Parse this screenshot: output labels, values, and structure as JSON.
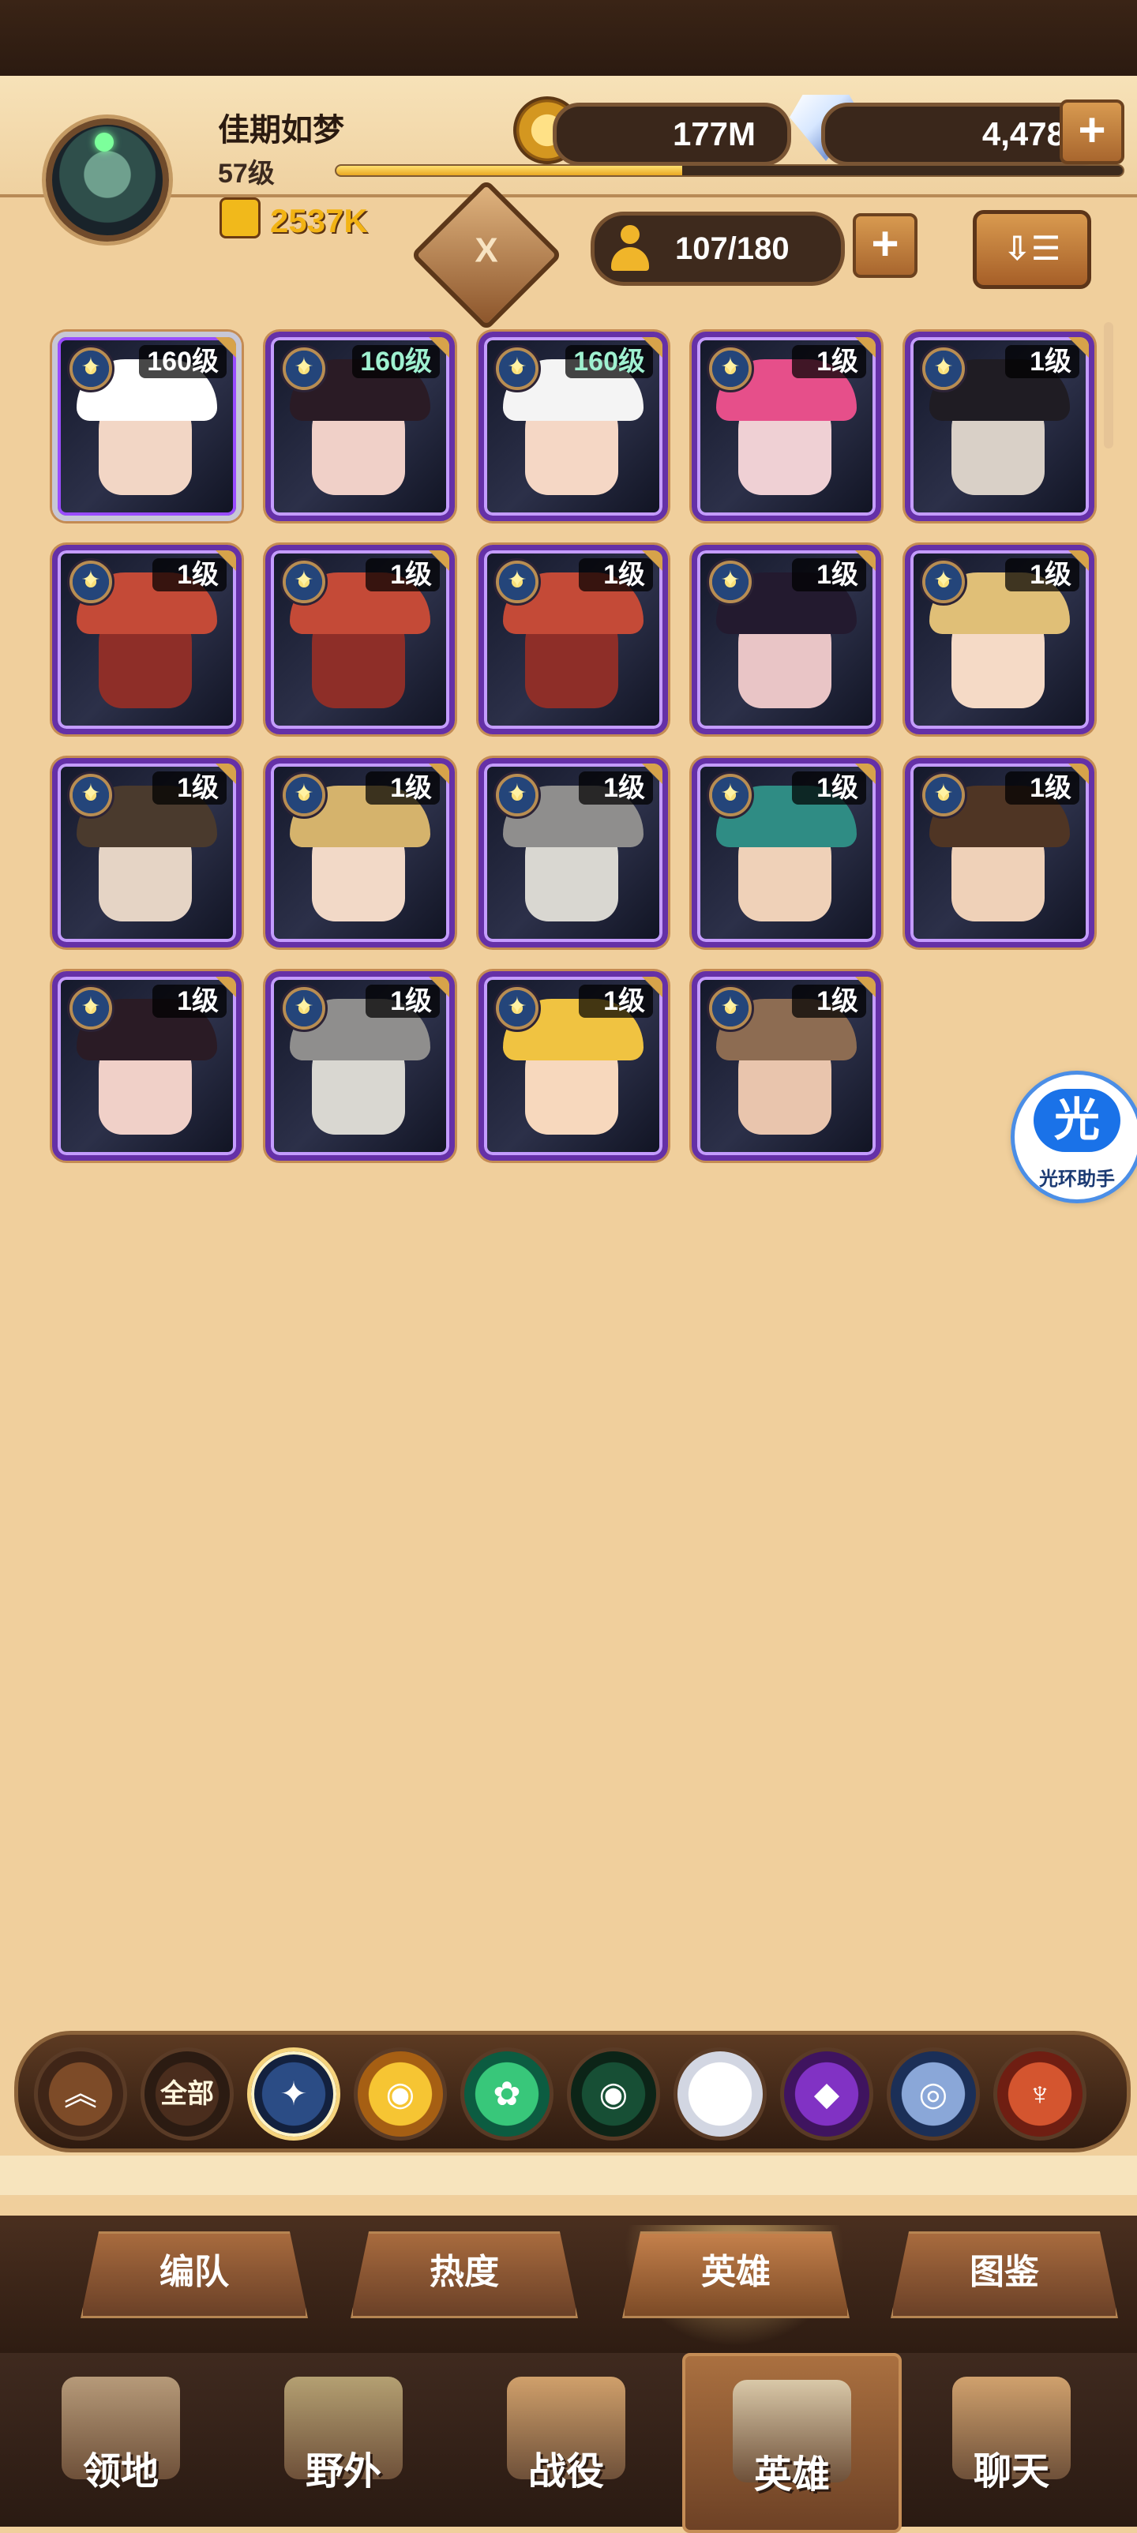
{
  "top": {
    "player_name": "佳期如梦",
    "player_level": "57级",
    "power": "2537K",
    "gold": "177M",
    "gems": "4,478",
    "plus": "+",
    "hero_count": "107/180",
    "formation_symbol": "X",
    "sort_symbol": "⇩☰",
    "xp_fraction": 0.44
  },
  "heroes": [
    {
      "level": "160级",
      "face": "#f2d6c5",
      "hair": "#ffffff",
      "gold": true,
      "green": false
    },
    {
      "level": "160级",
      "face": "#f0d0c8",
      "hair": "#2a1b25",
      "gold": false,
      "green": true
    },
    {
      "level": "160级",
      "face": "#f5d7c5",
      "hair": "#f4f4f4",
      "gold": false,
      "green": true
    },
    {
      "level": "1级",
      "face": "#efd0d4",
      "hair": "#e64f8a",
      "gold": false,
      "green": false
    },
    {
      "level": "1级",
      "face": "#d9d0c7",
      "hair": "#1f1c23",
      "gold": false,
      "green": false
    },
    {
      "level": "1级",
      "face": "#8e2e28",
      "hair": "#c44a37",
      "gold": false,
      "green": false
    },
    {
      "level": "1级",
      "face": "#8e2e28",
      "hair": "#c44a37",
      "gold": false,
      "green": false
    },
    {
      "level": "1级",
      "face": "#8e2e28",
      "hair": "#c44a37",
      "gold": false,
      "green": false
    },
    {
      "level": "1级",
      "face": "#e9c5c6",
      "hair": "#231a2f",
      "gold": false,
      "green": false
    },
    {
      "level": "1级",
      "face": "#f5dac6",
      "hair": "#e0bf77",
      "gold": false,
      "green": false
    },
    {
      "level": "1级",
      "face": "#e5d4c5",
      "hair": "#4a3a2d",
      "gold": false,
      "green": false
    },
    {
      "level": "1级",
      "face": "#f2d9c7",
      "hair": "#d5b36c",
      "gold": false,
      "green": false
    },
    {
      "level": "1级",
      "face": "#d9d7d1",
      "hair": "#8f8e8d",
      "gold": false,
      "green": false
    },
    {
      "level": "1级",
      "face": "#efd1b8",
      "hair": "#2f8c84",
      "gold": false,
      "green": false
    },
    {
      "level": "1级",
      "face": "#efd1b8",
      "hair": "#4f3524",
      "gold": false,
      "green": false
    },
    {
      "level": "1级",
      "face": "#f0d0c8",
      "hair": "#2a1b25",
      "gold": false,
      "green": false
    },
    {
      "level": "1级",
      "face": "#d9d7d1",
      "hair": "#8f8e8d",
      "gold": false,
      "green": false
    },
    {
      "level": "1级",
      "face": "#f7d8bd",
      "hair": "#f0c341",
      "gold": false,
      "green": false
    },
    {
      "level": "1级",
      "face": "#e9c5ad",
      "hair": "#8d6c52",
      "gold": false,
      "green": false
    }
  ],
  "helper": {
    "icon_text": "光",
    "label": "光环助手"
  },
  "filters": [
    {
      "label": "",
      "icon": "︽",
      "active": false,
      "c1": "#7d4b28",
      "c2": "#3f2517"
    },
    {
      "label": "全部",
      "icon": "",
      "active": false,
      "c1": "#4a2d1d",
      "c2": "#2b1b12"
    },
    {
      "label": "",
      "icon": "✦",
      "active": true,
      "c1": "#2b4c85",
      "c2": "#13213e"
    },
    {
      "label": "",
      "icon": "◉",
      "active": false,
      "c1": "#f6c533",
      "c2": "#a65f13"
    },
    {
      "label": "",
      "icon": "✿",
      "active": false,
      "c1": "#38c77a",
      "c2": "#0c5c41"
    },
    {
      "label": "",
      "icon": "◉",
      "active": false,
      "c1": "#174f35",
      "c2": "#0c2417"
    },
    {
      "label": "",
      "icon": "✦",
      "active": false,
      "c1": "#ffffff",
      "c2": "#d2d6e2"
    },
    {
      "label": "",
      "icon": "◆",
      "active": false,
      "c1": "#8132c4",
      "c2": "#3f145f"
    },
    {
      "label": "",
      "icon": "◎",
      "active": false,
      "c1": "#8aa7d8",
      "c2": "#1b2f57"
    },
    {
      "label": "",
      "icon": "♆",
      "active": false,
      "c1": "#d4552f",
      "c2": "#6f1e12"
    }
  ],
  "tabs": [
    {
      "label": "编队"
    },
    {
      "label": "热度"
    },
    {
      "label": "英雄"
    },
    {
      "label": "图鉴"
    }
  ],
  "nav": [
    {
      "label": "领地"
    },
    {
      "label": "野外"
    },
    {
      "label": "战役"
    },
    {
      "label": "英雄"
    },
    {
      "label": "聊天"
    }
  ]
}
